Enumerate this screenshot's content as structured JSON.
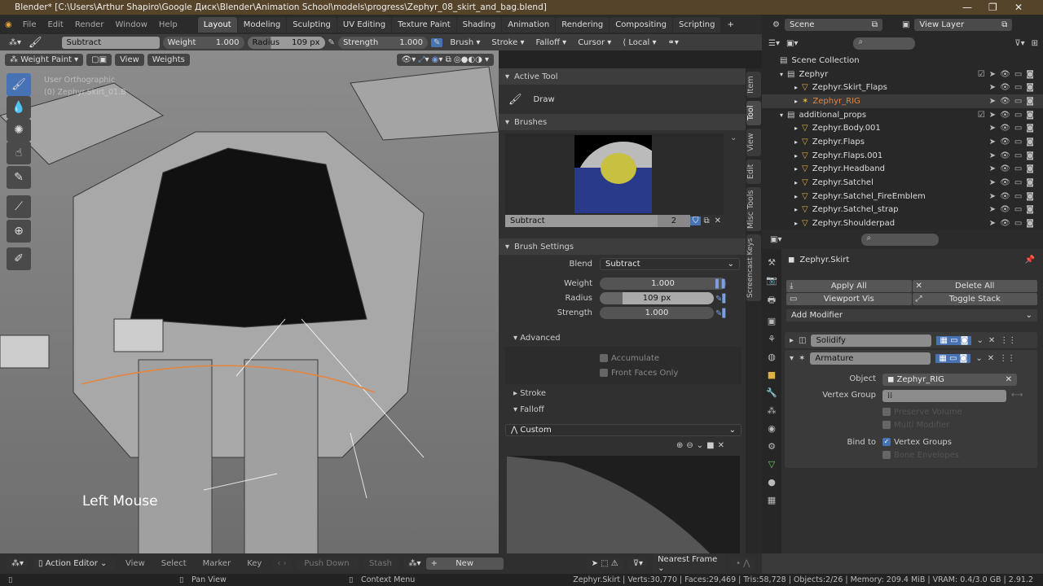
{
  "title": "Blender* [C:\\Users\\Arthur Shapiro\\Google Диск\\Blender\\Animation School\\models\\progress\\Zephyr_08_skirt_and_bag.blend]",
  "menu": [
    "File",
    "Edit",
    "Render",
    "Window",
    "Help"
  ],
  "workspaces": [
    "Layout",
    "Modeling",
    "Sculpting",
    "UV Editing",
    "Texture Paint",
    "Shading",
    "Animation",
    "Rendering",
    "Compositing",
    "Scripting",
    "+"
  ],
  "scene": "Scene",
  "view_layer": "View Layer",
  "toolhdr": {
    "brush": "Subtract",
    "weight_label": "Weight",
    "weight": "1.000",
    "radius_label": "Radius",
    "radius": "109 px",
    "strength_label": "Strength",
    "strength": "1.000",
    "brush_dd": "Brush",
    "stroke_dd": "Stroke",
    "falloff_dd": "Falloff",
    "cursor_dd": "Cursor",
    "orientation": "Local"
  },
  "viewport": {
    "mode": "Weight Paint",
    "view": "View",
    "weights": "Weights",
    "overlay1": "User Orthographic",
    "overlay2": "(0) Zephyr.Skirt_01.B",
    "screencast": "Left Mouse"
  },
  "npanel": {
    "active_tool": "Active Tool",
    "tool": "Draw",
    "brushes": "Brushes",
    "brush_name": "Subtract",
    "brush_users": "2",
    "brush_settings": "Brush Settings",
    "blend_label": "Blend",
    "blend": "Subtract",
    "weight_label": "Weight",
    "weight": "1.000",
    "radius_label": "Radius",
    "radius": "109 px",
    "strength_label": "Strength",
    "strength": "1.000",
    "advanced": "Advanced",
    "accumulate": "Accumulate",
    "front_faces": "Front Faces Only",
    "stroke": "Stroke",
    "falloff": "Falloff",
    "curve": "Custom"
  },
  "vtabs": [
    "Item",
    "Tool",
    "View",
    "Edit",
    "Misc Tools",
    "Screencast Keys"
  ],
  "outliner": {
    "root": "Scene Collection",
    "rows": [
      {
        "name": "Zephyr",
        "indent": 1,
        "type": "collection"
      },
      {
        "name": "Zephyr.Skirt_Flaps",
        "indent": 2,
        "type": "mesh"
      },
      {
        "name": "Zephyr_RIG",
        "indent": 2,
        "type": "armature",
        "selected": true
      },
      {
        "name": "additional_props",
        "indent": 1,
        "type": "collection"
      },
      {
        "name": "Zephyr.Body.001",
        "indent": 2,
        "type": "mesh"
      },
      {
        "name": "Zephyr.Flaps",
        "indent": 2,
        "type": "mesh"
      },
      {
        "name": "Zephyr.Flaps.001",
        "indent": 2,
        "type": "mesh"
      },
      {
        "name": "Zephyr.Headband",
        "indent": 2,
        "type": "mesh"
      },
      {
        "name": "Zephyr.Satchel",
        "indent": 2,
        "type": "mesh"
      },
      {
        "name": "Zephyr.Satchel_FireEmblem",
        "indent": 2,
        "type": "mesh"
      },
      {
        "name": "Zephyr.Satchel_strap",
        "indent": 2,
        "type": "mesh"
      },
      {
        "name": "Zephyr.Shoulderpad",
        "indent": 2,
        "type": "mesh"
      }
    ]
  },
  "props": {
    "object": "Zephyr.Skirt",
    "apply_all": "Apply All",
    "delete_all": "Delete All",
    "viewport_vis": "Viewport Vis",
    "toggle_stack": "Toggle Stack",
    "add_modifier": "Add Modifier",
    "mod1": "Solidify",
    "mod2": "Armature",
    "object_label": "Object",
    "object_value": "Zephyr_RIG",
    "vgroup_label": "Vertex Group",
    "preserve": "Preserve Volume",
    "multi": "Multi Modifier",
    "bind_label": "Bind to",
    "bind_vg": "Vertex Groups",
    "bind_env": "Bone Envelopes"
  },
  "timeline": {
    "editor": "Action Editor",
    "menus": [
      "View",
      "Select",
      "Marker",
      "Key"
    ],
    "push_down": "Push Down",
    "stash": "Stash",
    "new": "New",
    "snap": "Nearest Frame"
  },
  "status": {
    "pan": "Pan View",
    "context": "Context Menu",
    "stats": "Zephyr.Skirt | Verts:30,770 | Faces:29,469 | Tris:58,728 | Objects:2/26 | Memory: 209.4 MiB | VRAM: 0.4/3.0 GB | 2.91.2"
  },
  "colors": {
    "title": "#55442a",
    "accent": "#4772b3",
    "selected": "#e8843a"
  }
}
